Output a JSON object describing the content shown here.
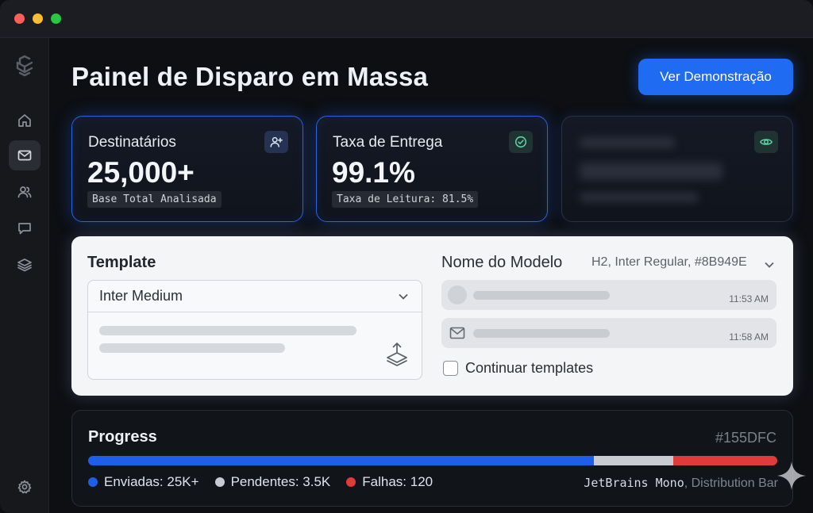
{
  "header": {
    "title": "Painel de Disparo em Massa",
    "demo_button": "Ver Demonstração"
  },
  "sidebar": {
    "items": [
      {
        "name": "logo",
        "icon": "app-logo-icon"
      },
      {
        "name": "home",
        "icon": "home-icon"
      },
      {
        "name": "mail",
        "icon": "mail-icon",
        "active": true
      },
      {
        "name": "users",
        "icon": "users-icon"
      },
      {
        "name": "chat",
        "icon": "chat-icon"
      },
      {
        "name": "layers",
        "icon": "layers-icon"
      },
      {
        "name": "settings",
        "icon": "settings-icon"
      }
    ]
  },
  "stats": [
    {
      "label": "Destinatários",
      "value": "25,000+",
      "sub": "Base Total Analisada",
      "icon": "user-add-icon"
    },
    {
      "label": "Taxa de Entrega",
      "value": "99.1%",
      "sub": "Taxa de Leitura: 81.5%",
      "icon": "check-circle-icon"
    },
    {
      "icon": "eye-icon"
    }
  ],
  "template": {
    "title": "Template",
    "select_value": "Inter Medium",
    "model_label": "Nome do Modelo",
    "model_meta": "H2, Inter Regular, #8B949E",
    "messages": [
      {
        "time": "11:53 AM"
      },
      {
        "time": "11:58 AM"
      }
    ],
    "checkbox_label": "Continuar templates"
  },
  "progress": {
    "title": "Progress",
    "hex_label": "#155DFC",
    "segments": [
      {
        "label": "Enviadas: 25K+",
        "fraction": 0.734,
        "color": "#1f5ee8"
      },
      {
        "label": "Pendentes: 3.5K",
        "fraction": 0.115,
        "color": "#c8cbd1"
      },
      {
        "label": "Falhas: 120",
        "fraction": 0.151,
        "color": "#e03a3a"
      }
    ],
    "font_name": "JetBrains Mono",
    "font_note": ", Distribution Bar"
  }
}
